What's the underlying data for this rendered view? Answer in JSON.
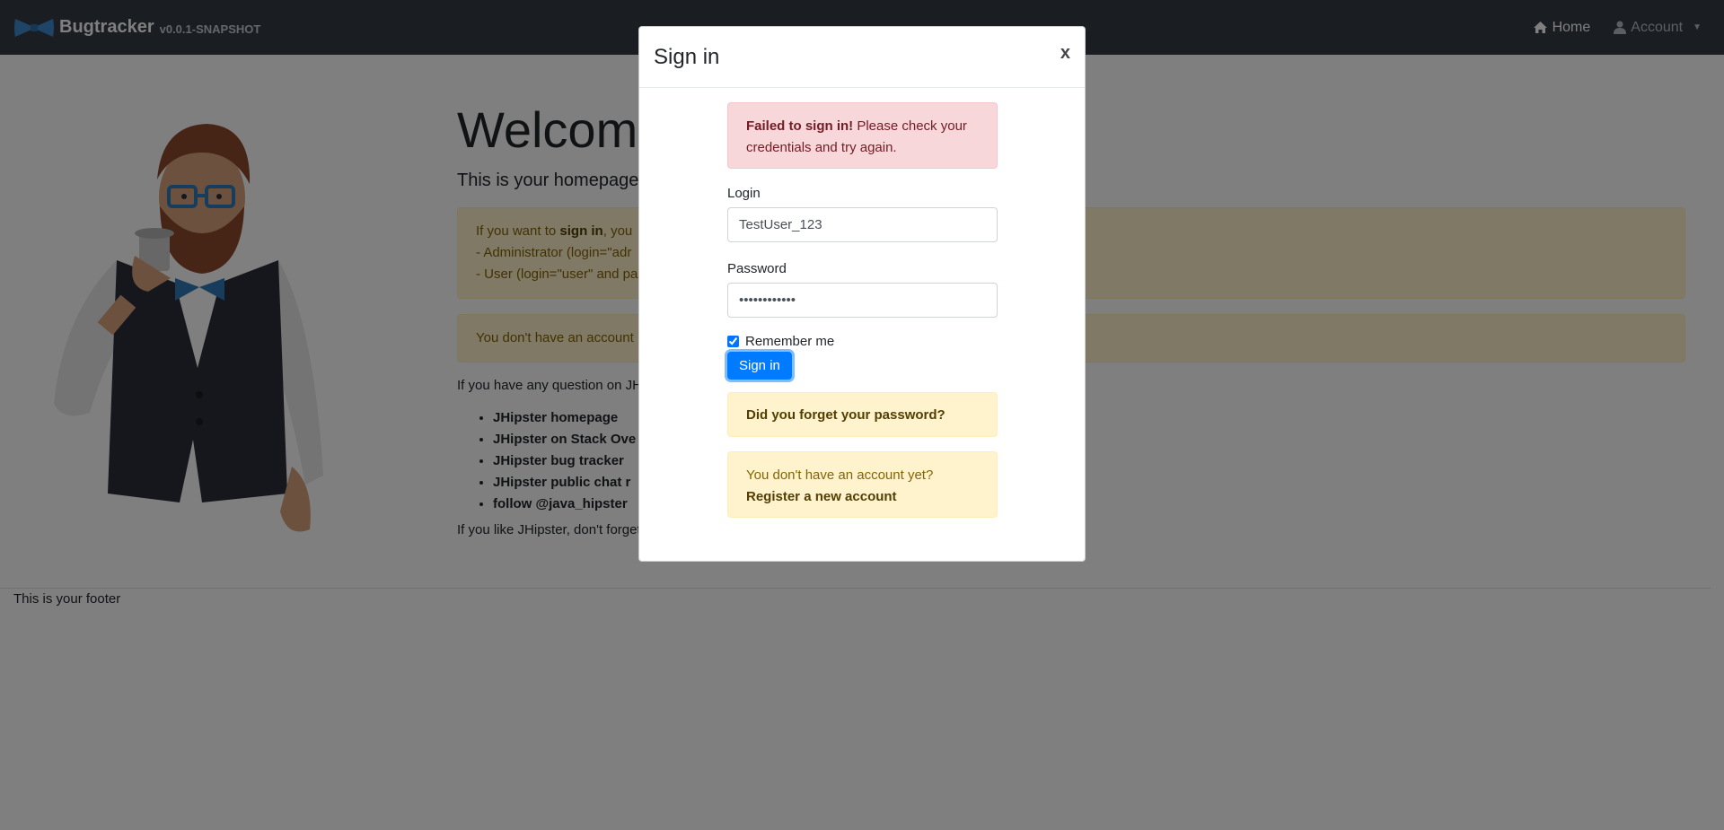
{
  "navbar": {
    "brand_name": "Bugtracker",
    "version": "v0.0.1-SNAPSHOT",
    "home_label": "Home",
    "account_label": "Account",
    "home_icon": "home-icon",
    "account_icon": "user-icon"
  },
  "main": {
    "welcome": "Welcome",
    "lead": "This is your homepage",
    "signin_alert": {
      "prefix": "If you want to ",
      "bold": "sign in",
      "suffix": ", you",
      "line2": "- Administrator (login=\"adr",
      "line3": "- User (login=\"user\" and pa"
    },
    "no_account_alert": "You don't have an account",
    "question": "If you have any question on JH",
    "links": [
      "JHipster homepage",
      "JHipster on Stack Ove",
      "JHipster bug tracker",
      "JHipster public chat r",
      "follow @java_hipster"
    ],
    "like": "If you like JHipster, don't forget"
  },
  "footer": {
    "text": "This is your footer"
  },
  "modal": {
    "title": "Sign in",
    "close_label": "x",
    "error": {
      "bold": "Failed to sign in!",
      "text": " Please check your credentials and try again."
    },
    "login_label": "Login",
    "login_value": "TestUser_123",
    "password_label": "Password",
    "password_value": "TestPass1234",
    "remember_label": "Remember me",
    "remember_checked": true,
    "signin_button": "Sign in",
    "forgot_link": "Did you forget your password?",
    "no_account_text": "You don't have an account yet?",
    "register_link": "Register a new account"
  },
  "colors": {
    "navbar": "#353d47",
    "primary": "#007bff",
    "danger_bg": "#f8d7da",
    "warning_bg": "#fff3cd"
  }
}
